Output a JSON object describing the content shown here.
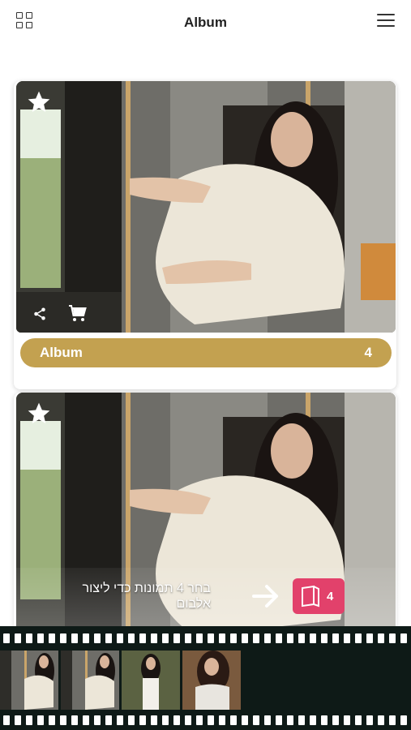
{
  "header": {
    "title": "Album"
  },
  "cards": [
    {
      "album_label": "Album",
      "album_count": "4"
    },
    {
      "album_label": "",
      "album_count": ""
    }
  ],
  "selection_bar": {
    "instruction": "בחר 4 תמונות  כדי ליצור אלבום",
    "selected_count": "4"
  },
  "colors": {
    "accent_gold": "#c3a150",
    "badge_pink": "#e2416b",
    "filmstrip_bg": "#0e1a17"
  },
  "icons": {
    "grid": "grid-icon",
    "menu": "menu-icon",
    "favorite": "star-icon",
    "share": "share-icon",
    "cart": "cart-icon",
    "arrow": "arrow-right-icon",
    "book": "book-icon"
  },
  "filmstrip": {
    "thumbnail_count": 4
  }
}
